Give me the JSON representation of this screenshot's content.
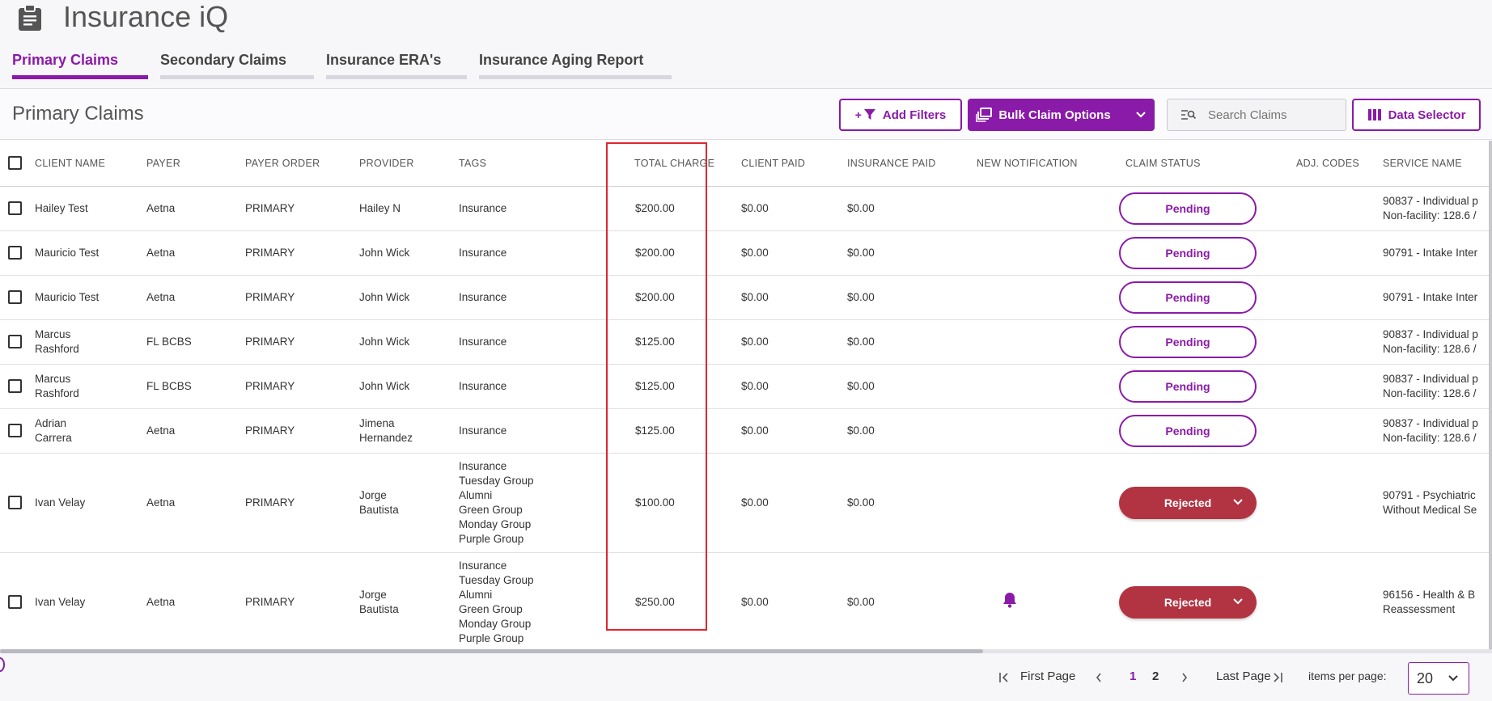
{
  "app": {
    "title": "Insurance iQ"
  },
  "tabs": [
    {
      "label": "Primary Claims",
      "active": true
    },
    {
      "label": "Secondary Claims",
      "active": false
    },
    {
      "label": "Insurance ERA's",
      "active": false
    },
    {
      "label": "Insurance Aging Report",
      "active": false
    }
  ],
  "toolbar": {
    "page_title": "Primary Claims",
    "add_filters_prefix": "+",
    "add_filters": "Add Filters",
    "bulk_options": "Bulk Claim Options",
    "search_placeholder": "Search Claims",
    "data_selector": "Data Selector"
  },
  "table": {
    "columns": [
      "CLIENT NAME",
      "PAYER",
      "PAYER ORDER",
      "PROVIDER",
      "TAGS",
      "TOTAL CHARGE",
      "CLIENT PAID",
      "INSURANCE PAID",
      "NEW NOTIFICATION",
      "CLAIM STATUS",
      "ADJ. CODES",
      "SERVICE NAME"
    ],
    "rows": [
      {
        "client": [
          "Hailey Test"
        ],
        "payer": "Aetna",
        "order": "PRIMARY",
        "provider": [
          "Hailey N"
        ],
        "tags": [
          "Insurance"
        ],
        "total": "$200.00",
        "client_paid": "$0.00",
        "ins_paid": "$0.00",
        "notification": false,
        "status": "Pending",
        "service": [
          "90837 - Individual p",
          "Non-facility: 128.6 /"
        ]
      },
      {
        "client": [
          "Mauricio Test"
        ],
        "payer": "Aetna",
        "order": "PRIMARY",
        "provider": [
          "John Wick"
        ],
        "tags": [
          "Insurance"
        ],
        "total": "$200.00",
        "client_paid": "$0.00",
        "ins_paid": "$0.00",
        "notification": false,
        "status": "Pending",
        "service": [
          "90791 - Intake Inter"
        ]
      },
      {
        "client": [
          "Mauricio Test"
        ],
        "payer": "Aetna",
        "order": "PRIMARY",
        "provider": [
          "John Wick"
        ],
        "tags": [
          "Insurance"
        ],
        "total": "$200.00",
        "client_paid": "$0.00",
        "ins_paid": "$0.00",
        "notification": false,
        "status": "Pending",
        "service": [
          "90791 - Intake Inter"
        ]
      },
      {
        "client": [
          "Marcus",
          "Rashford"
        ],
        "payer": "FL BCBS",
        "order": "PRIMARY",
        "provider": [
          "John Wick"
        ],
        "tags": [
          "Insurance"
        ],
        "total": "$125.00",
        "client_paid": "$0.00",
        "ins_paid": "$0.00",
        "notification": false,
        "status": "Pending",
        "service": [
          "90837 - Individual p",
          "Non-facility: 128.6 /"
        ]
      },
      {
        "client": [
          "Marcus",
          "Rashford"
        ],
        "payer": "FL BCBS",
        "order": "PRIMARY",
        "provider": [
          "John Wick"
        ],
        "tags": [
          "Insurance"
        ],
        "total": "$125.00",
        "client_paid": "$0.00",
        "ins_paid": "$0.00",
        "notification": false,
        "status": "Pending",
        "service": [
          "90837 - Individual p",
          "Non-facility: 128.6 /"
        ]
      },
      {
        "client": [
          "Adrian",
          "Carrera"
        ],
        "payer": "Aetna",
        "order": "PRIMARY",
        "provider": [
          "Jimena",
          "Hernandez"
        ],
        "tags": [
          "Insurance"
        ],
        "total": "$125.00",
        "client_paid": "$0.00",
        "ins_paid": "$0.00",
        "notification": false,
        "status": "Pending",
        "service": [
          "90837 - Individual p",
          "Non-facility: 128.6 /"
        ]
      },
      {
        "client": [
          "Ivan Velay"
        ],
        "payer": "Aetna",
        "order": "PRIMARY",
        "provider": [
          "Jorge",
          "Bautista"
        ],
        "tags": [
          "Insurance",
          "Tuesday Group",
          "Alumni",
          "Green Group",
          "Monday Group",
          "Purple Group"
        ],
        "total": "$100.00",
        "client_paid": "$0.00",
        "ins_paid": "$0.00",
        "notification": false,
        "status": "Rejected",
        "service": [
          "90791 - Psychiatric",
          "Without Medical Se"
        ]
      },
      {
        "client": [
          "Ivan Velay"
        ],
        "payer": "Aetna",
        "order": "PRIMARY",
        "provider": [
          "Jorge",
          "Bautista"
        ],
        "tags": [
          "Insurance",
          "Tuesday Group",
          "Alumni",
          "Green Group",
          "Monday Group",
          "Purple Group"
        ],
        "total": "$250.00",
        "client_paid": "$0.00",
        "ins_paid": "$0.00",
        "notification": true,
        "status": "Rejected",
        "service": [
          "96156 - Health & B",
          "Reassessment"
        ]
      }
    ]
  },
  "pagination": {
    "first": "First Page",
    "pages": [
      "1",
      "2"
    ],
    "active_page": "1",
    "last": "Last Page",
    "per_page_label": "items per page:",
    "per_page_value": "20"
  },
  "colors": {
    "accent": "#8a1aa8",
    "rejected": "#b23442",
    "highlight": "#e0262e"
  }
}
